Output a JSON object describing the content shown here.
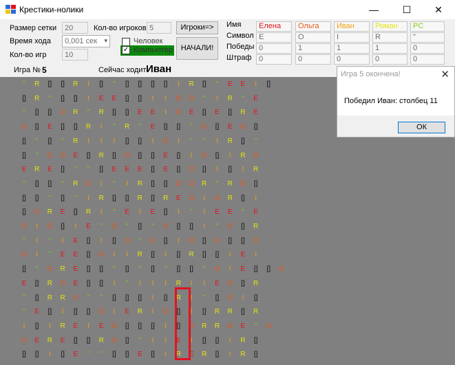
{
  "window": {
    "title": "Крестики-нолики",
    "min": "—",
    "max": "☐",
    "close": "✕"
  },
  "settings": {
    "grid_size_label": "Размер сетки",
    "grid_size": "20",
    "players_count_label": "Кол-во игроков",
    "players_count": "5",
    "move_time_label": "Время хода",
    "move_time": "0,001 сек",
    "games_count_label": "Кол-во игр",
    "games_count": "10",
    "players_button": "Игроки=>",
    "start_button": "НАЧАЛИ!",
    "human_label": "Человек",
    "human_checked": false,
    "computer_label": "Компьютер",
    "computer_checked": true
  },
  "players_table": {
    "row_labels": [
      "Имя",
      "Символ",
      "Победы",
      "Штраф"
    ],
    "players": [
      {
        "name": "Елена",
        "symbol": "E",
        "wins": "0",
        "penalty": "0",
        "color": "#e0141e"
      },
      {
        "name": "Ольга",
        "symbol": "O",
        "wins": "1",
        "penalty": "0",
        "color": "#e8541b"
      },
      {
        "name": "Иван",
        "symbol": "I",
        "wins": "1",
        "penalty": "0",
        "color": "#f0a010"
      },
      {
        "name": "Роман",
        "symbol": "R",
        "wins": "1",
        "penalty": "0",
        "color": "#e5e510"
      },
      {
        "name": "PC",
        "symbol": "\"",
        "wins": "0",
        "penalty": "0",
        "color": "#84ce14"
      }
    ]
  },
  "status": {
    "game_label": "Игра №",
    "game_number": "5",
    "turn_label": "Сейчас ходит:",
    "turn_player": "Иван"
  },
  "board": {
    "colors": {
      "E": "#e0141e",
      "O": "#e8541b",
      "I": "#f0a010",
      "R": "#e5e510",
      "\"": "#84ce14",
      "[]": "#111111"
    },
    "rows": [
      "\" R [] [] R I [] \" [] [] [] [] I R [] \" E E I []",
      "[] R \" [] [] I E E [] [] I I O O \" I R \" E",
      "\" [] [] O R \" R [] [] E E I O E [] E [] R E",
      "O [] E [] [] R I \" R \" E [] [] \" O [] E O []",
      "[] \" [] \" R I I I [] [] I O I \" \" I R [] \"",
      "[] \" O O E [] R [] O [] [] E [] I O [] I R O",
      "E R E [] \" \" [] E E E [] E [] O [] I [] I R",
      "\" [] [] \" R O I \" I R [] [] O O R \" R O []",
      "[] [] \" [] \" I R [] [] R [] R E O I O R [] I",
      "[] O R E [] R I \" E I E [] I \" I E E \" E",
      "O I O [] I E \" O \" [] \" O [] [] I \" O [] R",
      "\" I \" I E [] I [] O \" O [] I O [] O [] [] O",
      "O I \" E E [] O I I R [] I [] R [] [] I E I",
      "[] \" O R E [] [] \" [] \" [] \" [] [] \" O I E [] [] O",
      "E [] R O E [] [] I \" I I I R I I E O [] R",
      "\" [] R R O \" \" [] [] [] I [] R I \" [] O I []",
      "\" E [] I [] [] O I E R I O [] I [] R R [] R",
      "I [] I R E I E O [] [] [] I [] O R R O E \" O",
      "O E R E [] [] R O [] \" I I E I [] [] I R []",
      "[] [] I [] E \" \" [] [] E [] I R E R [] I R []"
    ]
  },
  "dialog": {
    "title": "Игра 5 окончена!",
    "close": "✕",
    "message": "Победил Иван: столбец 11",
    "ok": "ОК"
  }
}
